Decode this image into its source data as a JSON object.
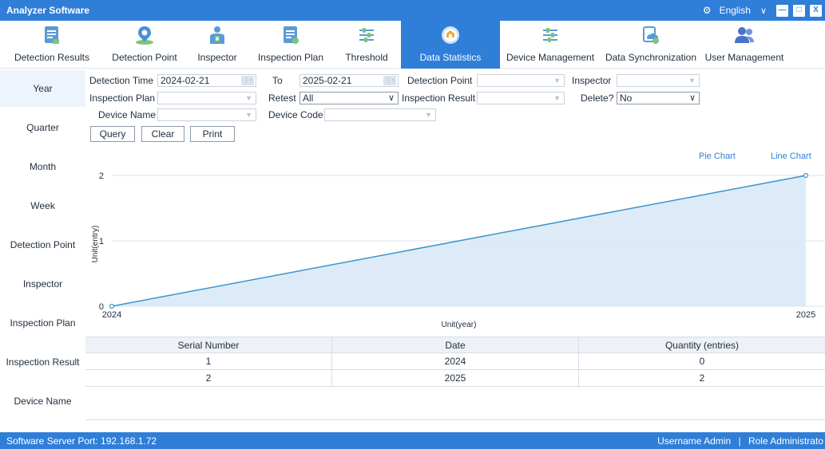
{
  "window": {
    "title": "Analyzer Software",
    "language": "English",
    "minimize": "—",
    "maximize": "□",
    "close": "X"
  },
  "nav": [
    {
      "label": "Detection Results",
      "icon": "report-icon"
    },
    {
      "label": "Detection Point",
      "icon": "map-pin-icon"
    },
    {
      "label": "Inspector",
      "icon": "inspector-icon"
    },
    {
      "label": "Inspection Plan",
      "icon": "plan-icon"
    },
    {
      "label": "Threshold",
      "icon": "threshold-icon"
    },
    {
      "label": "Data Statistics",
      "icon": "statistics-icon",
      "active": true
    },
    {
      "label": "Device Management",
      "icon": "device-icon"
    },
    {
      "label": "Data Synchronization",
      "icon": "sync-icon"
    },
    {
      "label": "User Management",
      "icon": "users-icon"
    }
  ],
  "sidebar": [
    {
      "label": "Year",
      "active": true
    },
    {
      "label": "Quarter"
    },
    {
      "label": "Month"
    },
    {
      "label": "Week"
    },
    {
      "label": "Detection Point"
    },
    {
      "label": "Inspector"
    },
    {
      "label": "Inspection Plan"
    },
    {
      "label": "Inspection Result"
    },
    {
      "label": "Device Name"
    }
  ],
  "filters": {
    "detection_time_label": "Detection Time",
    "detection_time_value": "2024-02-21",
    "to_label": "To",
    "to_value": "2025-02-21",
    "detection_point_label": "Detection Point",
    "detection_point_value": "",
    "inspector_label": "Inspector",
    "inspector_value": "",
    "inspection_plan_label": "Inspection Plan",
    "inspection_plan_value": "",
    "retest_label": "Retest",
    "retest_value": "All",
    "inspection_result_label": "Inspection Result",
    "inspection_result_value": "",
    "delete_label": "Delete?",
    "delete_value": "No",
    "device_name_label": "Device Name",
    "device_name_value": "",
    "device_code_label": "Device Code",
    "device_code_value": ""
  },
  "buttons": {
    "query": "Query",
    "clear": "Clear",
    "print": "Print"
  },
  "chart_toggle": {
    "pie": "Pie Chart",
    "line": "Line Chart"
  },
  "chart_data": {
    "type": "line",
    "x": [
      "2024",
      "2025"
    ],
    "values": [
      0,
      2
    ],
    "xlabel": "Unit(year)",
    "ylabel": "Unit(entry)",
    "ylim": [
      0,
      2
    ],
    "yticks": [
      "0",
      "1",
      "2"
    ],
    "grid": true,
    "area_fill": true,
    "color": "#3a95c9",
    "fill_color": "#d9e9f7"
  },
  "table": {
    "headers": [
      "Serial Number",
      "Date",
      "Quantity (entries)"
    ],
    "rows": [
      [
        "1",
        "2024",
        "0"
      ],
      [
        "2",
        "2025",
        "2"
      ]
    ]
  },
  "status": {
    "server": "Software Server Port: 192.168.1.72",
    "username_label": "Username",
    "username": "Admin",
    "role_label": "Role",
    "role": "Administrato"
  },
  "colors": {
    "accent": "#2f7ed8"
  }
}
